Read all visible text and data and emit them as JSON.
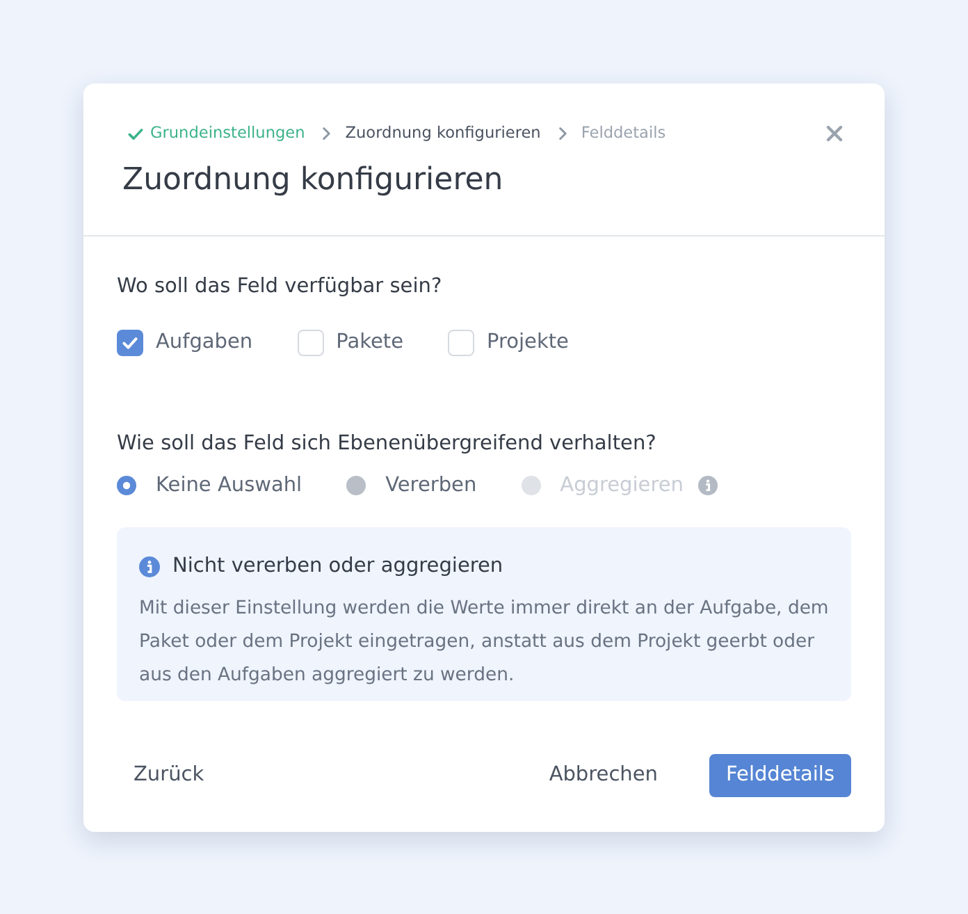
{
  "breadcrumb": [
    {
      "label": "Grundeinstellungen",
      "kind": "done"
    },
    {
      "label": "Zuordnung konfigurieren",
      "kind": "current"
    },
    {
      "label": "Felddetails",
      "kind": "upcoming"
    }
  ],
  "dialog": {
    "title": "Zuordnung konfigurieren"
  },
  "availability": {
    "question": "Wo soll das Feld verfügbar sein?",
    "options": [
      {
        "label": "Aufgaben",
        "checked": true
      },
      {
        "label": "Pakete",
        "checked": false
      },
      {
        "label": "Projekte",
        "checked": false
      }
    ]
  },
  "behavior": {
    "question": "Wie soll das Feld sich Ebenenübergreifend verhalten?",
    "options": [
      {
        "label": "Keine Auswahl",
        "selected": true,
        "disabled": false
      },
      {
        "label": "Vererben",
        "selected": false,
        "disabled": false
      },
      {
        "label": "Aggregieren",
        "selected": false,
        "disabled": true,
        "info_icon": true
      }
    ]
  },
  "info_box": {
    "title": "Nicht vererben oder aggregieren",
    "text": "Mit dieser Einstellung werden die Werte immer direkt an der Aufgabe, dem Paket oder dem Projekt eingetragen, anstatt aus dem Projekt geerbt oder aus den Aufgaben aggregiert zu werden."
  },
  "footer": {
    "left": [
      {
        "label": "Zurück",
        "kind": "text"
      }
    ],
    "right": [
      {
        "label": "Abbrechen",
        "kind": "text"
      },
      {
        "label": "Felddetails",
        "kind": "primary"
      }
    ]
  }
}
